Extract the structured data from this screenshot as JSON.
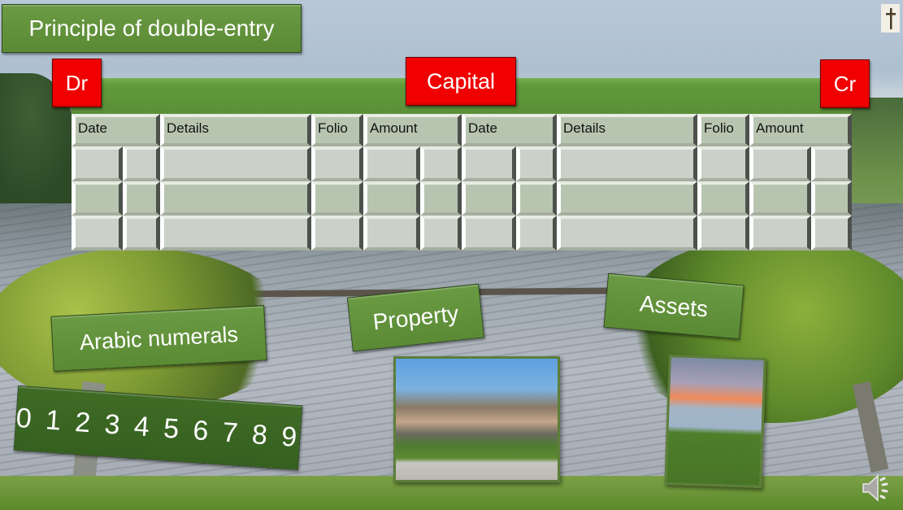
{
  "slide": {
    "title": "Principle of double-entry",
    "labels": {
      "arabic_numerals": "Arabic numerals",
      "digits": "0 1 2 3 4 5 6 7 8 9",
      "property": "Property",
      "assets": "Assets"
    },
    "ledger": {
      "debit_label": "Dr",
      "account_name": "Capital",
      "credit_label": "Cr",
      "columns": [
        "Date",
        "Details",
        "Folio",
        "Amount",
        "Date",
        "Details",
        "Folio",
        "Amount"
      ],
      "row_count": 3
    },
    "icons": {
      "top_right": "crucifix-icon",
      "bottom_right": "speaker-icon"
    },
    "images": {
      "house": "house-photo",
      "yard": "backyard-photo"
    },
    "colors": {
      "label_green": "#5b8a35",
      "red_badge": "#f00000",
      "header_cell": "#b7c5b0",
      "body_cell": "#cbd0c8"
    }
  }
}
